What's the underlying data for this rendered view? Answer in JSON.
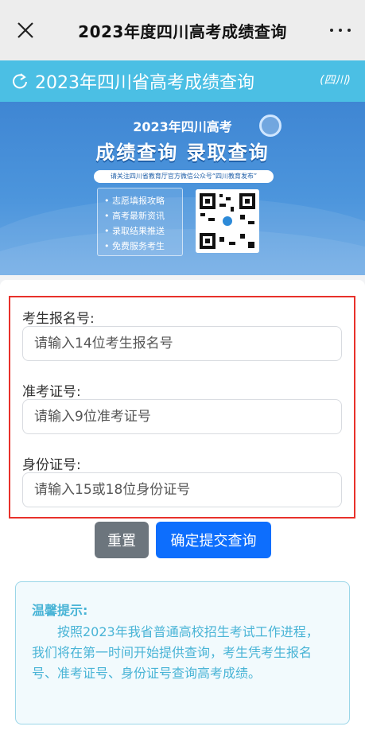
{
  "topbar": {
    "title": "2023年度四川高考成绩查询"
  },
  "header": {
    "title": "2023年四川省高考成绩查询",
    "tag": "(四川)"
  },
  "banner": {
    "year_line": "2023年四川高考",
    "main_line": "成绩查询 录取查询",
    "note": "请关注四川省教育厅官方微信公众号“四川教育发布”",
    "features": [
      "志愿填报攻略",
      "高考最新资讯",
      "录取结果推送",
      "免费服务考生"
    ]
  },
  "form": {
    "reg_label": "考生报名号:",
    "reg_placeholder": "请输入14位考生报名号",
    "exam_label": "准考证号:",
    "exam_placeholder": "请输入9位准考证号",
    "id_label": "身份证号:",
    "id_placeholder": "请输入15或18位身份证号"
  },
  "buttons": {
    "reset": "重置",
    "submit": "确定提交查询"
  },
  "tip": {
    "title": "温馨提示:",
    "body": "按照2023年我省普通高校招生考试工作进程，我们将在第一时间开始提供查询，考生凭考生报名号、准考证号、身份证号查询高考成绩。"
  },
  "colors": {
    "header_bg": "#4bbfe4",
    "submit_bg": "#0d6efd",
    "reset_bg": "#6c757d",
    "highlight_border": "#e8312b",
    "tip_text": "#49b4d6"
  },
  "icons": {
    "close": "close-icon",
    "more": "more-icon",
    "refresh": "refresh-icon",
    "search": "search-icon",
    "qr": "qr-code"
  }
}
